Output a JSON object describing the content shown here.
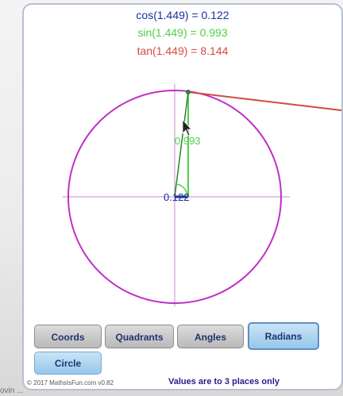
{
  "readouts": {
    "cos": "cos(1.449) = 0.122",
    "sin": "sin(1.449) = 0.993",
    "tan": "tan(1.449) = 8.144"
  },
  "diagram": {
    "sin_label": "0.993",
    "cos_label": "0.122",
    "angle_radians": 1.449,
    "cos_value": 0.122,
    "sin_value": 0.993
  },
  "buttons": {
    "coords": "Coords",
    "quadrants": "Quadrants",
    "angles": "Angles",
    "radians": "Radians",
    "circle": "Circle"
  },
  "footer": {
    "copyright": "© 2017 MathsIsFun.com v0.82",
    "note": "Values are to 3 places only"
  },
  "corner_text": "ovin ...",
  "colors": {
    "circle": "#c030c8",
    "axes": "#c98ad0",
    "sin": "#4fd04a",
    "cos": "#1a2fa0",
    "tan": "#d24a44",
    "radius": "#2f7f2f"
  }
}
